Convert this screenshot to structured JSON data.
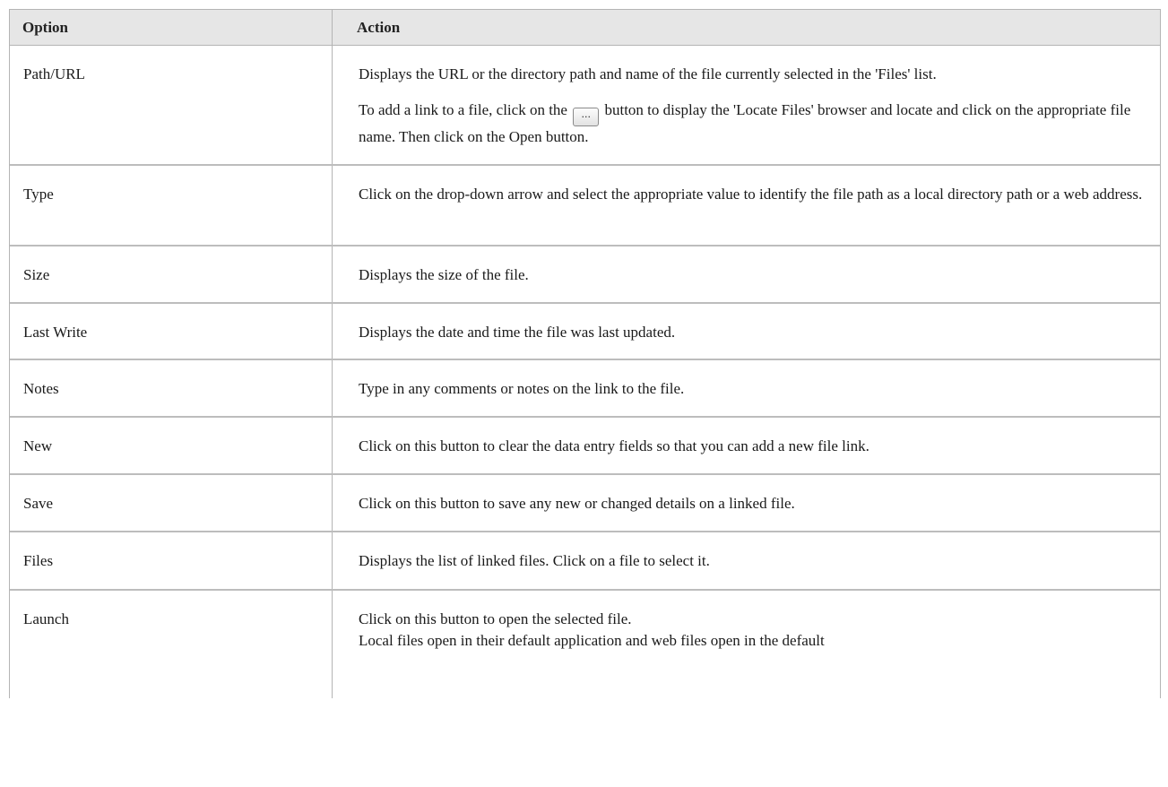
{
  "table": {
    "headers": {
      "option": "Option",
      "action": "Action"
    },
    "rows": [
      {
        "option": "Path/URL",
        "action_p1": "Displays the URL or the directory path and name of the file currently selected in the 'Files' list.",
        "action_p2_before": "To add a link to a file, click on the",
        "browse_button_label": "...",
        "action_p2_after": "button to display the 'Locate Files' browser and locate and click on the appropriate file name. Then click on the Open button."
      },
      {
        "option": "Type",
        "action": "Click on the drop-down arrow and select the appropriate value to identify the file path as a local directory path or a web address."
      },
      {
        "option": "Size",
        "action": "Displays the size of the file."
      },
      {
        "option": "Last Write",
        "action": "Displays the date and time the file was last updated."
      },
      {
        "option": "Notes",
        "action": "Type in any comments or notes on the link to the file."
      },
      {
        "option": "New",
        "action": "Click on this button to clear the data entry fields so that you can add a new file link."
      },
      {
        "option": "Save",
        "action": "Click on this button to save any new or changed details on a linked file."
      },
      {
        "option": "Files",
        "action": "Displays the list of linked files. Click on a file to select it."
      },
      {
        "option": "Launch",
        "action_p1": "Click on this button to open the selected file.",
        "action_p2": "Local files open in their default application and web files open in the default"
      }
    ]
  }
}
